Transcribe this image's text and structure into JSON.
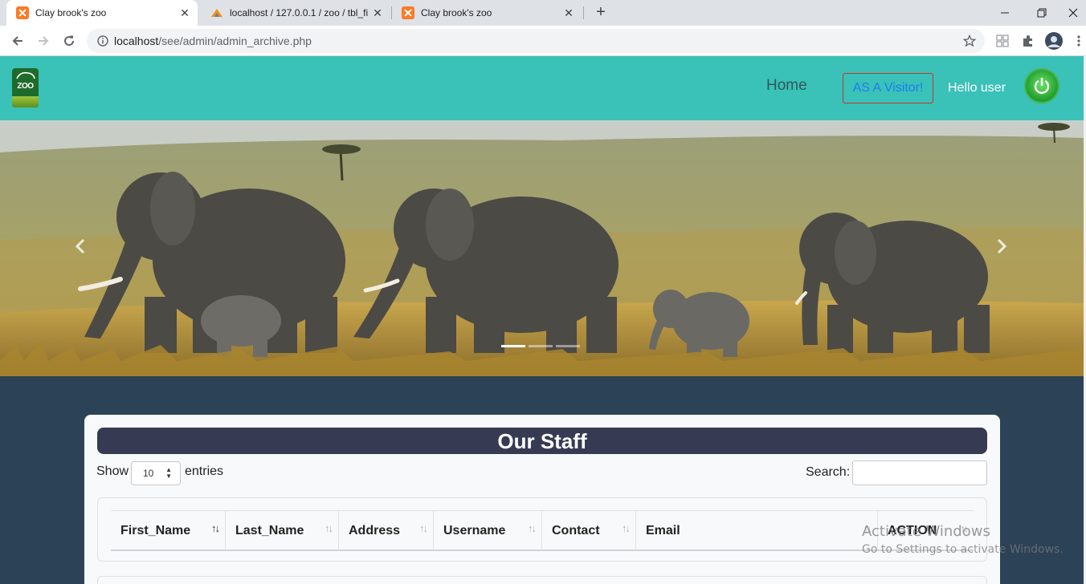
{
  "browser": {
    "tabs": [
      {
        "title": "Clay brook's zoo",
        "active": true
      },
      {
        "title": "localhost / 127.0.0.1 / zoo / tbl_fi",
        "active": false
      },
      {
        "title": "Clay brook's zoo",
        "active": false
      }
    ],
    "url_host": "localhost",
    "url_path": "/see/admin/admin_archive.php"
  },
  "header": {
    "logo_text": "ZOO",
    "nav_home": "Home",
    "visitor_button": "AS A Visitor!",
    "greeting": "Hello user"
  },
  "carousel": {
    "indicator_count": 3,
    "active_index": 0
  },
  "staff": {
    "title": "Our Staff",
    "show_label": "Show",
    "entries_value": "10",
    "entries_label": "entries",
    "search_label": "Search:",
    "columns": [
      "First_Name",
      "Last_Name",
      "Address",
      "Username",
      "Contact",
      "Email",
      "ACTION"
    ]
  },
  "watermark": {
    "line1": "Activate Windows",
    "line2": "Go to Settings to activate Windows."
  },
  "colors": {
    "header_bg": "#3ac1b8",
    "page_bg": "#2c4257",
    "title_bar": "#363a52"
  }
}
